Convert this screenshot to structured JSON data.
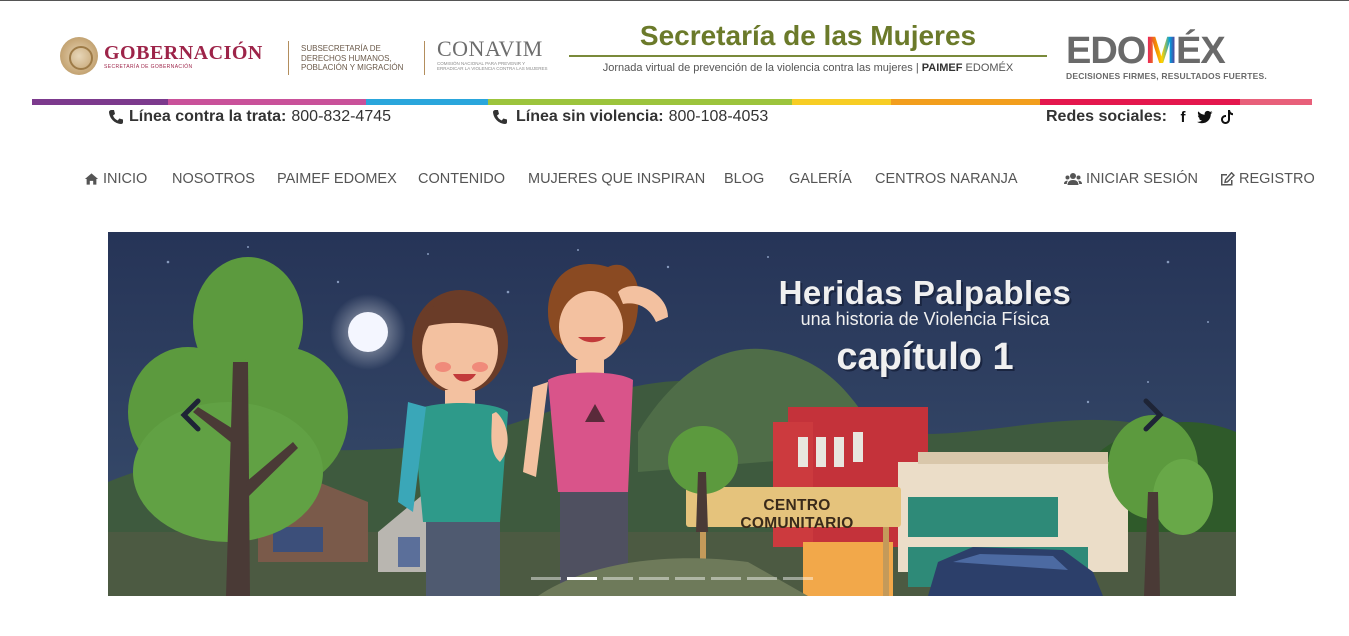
{
  "header": {
    "gobernacion": {
      "title": "GOBERNACIÓN",
      "subtitle": "SECRETARÍA DE GOBERNACIÓN"
    },
    "subsecretaria": "SUBSECRETARÍA DE DERECHOS HUMANOS, POBLACIÓN Y MIGRACIÓN",
    "conavim": {
      "title": "CONAVIM",
      "subtitle": "COMISIÓN NACIONAL PARA PREVENIR Y ERRADICAR LA VIOLENCIA CONTRA LAS MUJERES"
    },
    "secretaria": {
      "title": "Secretaría de las Mujeres",
      "subtitle_prefix": "Jornada virtual de prevención de la violencia contra las mujeres | ",
      "subtitle_bold": "PAIMEF",
      "subtitle_suffix": " EDOMÉX"
    },
    "edomex": {
      "title_a": "EDO",
      "title_m": "M",
      "title_b": "ÉX",
      "slogan": "DECISIONES FIRMES, RESULTADOS FUERTES."
    }
  },
  "rainbow_colors": [
    "#7c3a8d",
    "#c9519a",
    "#2aa6dc",
    "#9cc43c",
    "#f7cd24",
    "#f29e1d",
    "#e4174d",
    "#e8607a"
  ],
  "contact": {
    "trata_label": "Línea contra la trata:",
    "trata_number": "800-832-4745",
    "violencia_label": "Línea sin violencia:",
    "violencia_number": "800-108-4053",
    "social_label": "Redes sociales:",
    "social_icons": [
      "facebook-icon",
      "twitter-icon",
      "tiktok-icon"
    ]
  },
  "nav": {
    "items": [
      "INICIO",
      "NOSOTROS",
      "PAIMEF EDOMEX",
      "CONTENIDO",
      "MUJERES QUE INSPIRAN",
      "BLOG",
      "GALERÍA",
      "CENTROS NARANJA"
    ],
    "login": "INICIAR SESIÓN",
    "register": "REGISTRO"
  },
  "carousel": {
    "title": "Heridas Palpables",
    "subtitle": "una historia de Violencia Física",
    "chapter": "capítulo 1",
    "sign": "CENTRO COMUNITARIO",
    "slide_count": 8,
    "active_slide": 2
  }
}
